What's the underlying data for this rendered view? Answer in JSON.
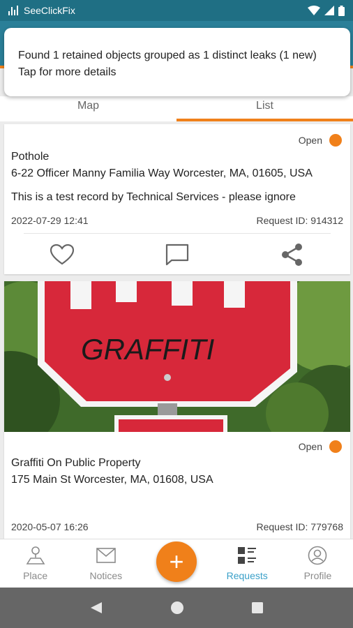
{
  "status_bar": {
    "app_name": "SeeClickFix"
  },
  "toast": {
    "line1": "Found 1 retained objects grouped as 1 distinct leaks (1 new)",
    "line2": "Tap for more details"
  },
  "tabs": [
    {
      "label": "Map",
      "active": false
    },
    {
      "label": "List",
      "active": true
    }
  ],
  "requests": [
    {
      "status": "Open",
      "title": "Pothole",
      "address": "6-22 Officer Manny Familia Way Worcester, MA, 01605, USA",
      "description": "This is a test record by Technical Services - please ignore",
      "date": "2022-07-29 12:41",
      "request_id": "Request ID: 914312",
      "actions": [
        "heart-icon",
        "comment-icon",
        "share-icon"
      ]
    },
    {
      "status": "Open",
      "title": "Graffiti On Public Property",
      "address": "175 Main St Worcester, MA, 01608, USA",
      "date": "2020-05-07 16:26",
      "request_id": "Request ID: 779768",
      "photo": "stop-sign-graffiti-photo"
    }
  ],
  "bottom_nav": [
    {
      "label": "Place",
      "icon": "place-icon"
    },
    {
      "label": "Notices",
      "icon": "mail-icon"
    },
    {
      "label": "Requests",
      "icon": "list-icon",
      "active": true
    },
    {
      "label": "Profile",
      "icon": "profile-icon"
    }
  ],
  "fab": {
    "label": "+"
  },
  "colors": {
    "accent": "#f0801a",
    "toolbar": "#2a7f98",
    "active_nav": "#3aa0c8"
  }
}
